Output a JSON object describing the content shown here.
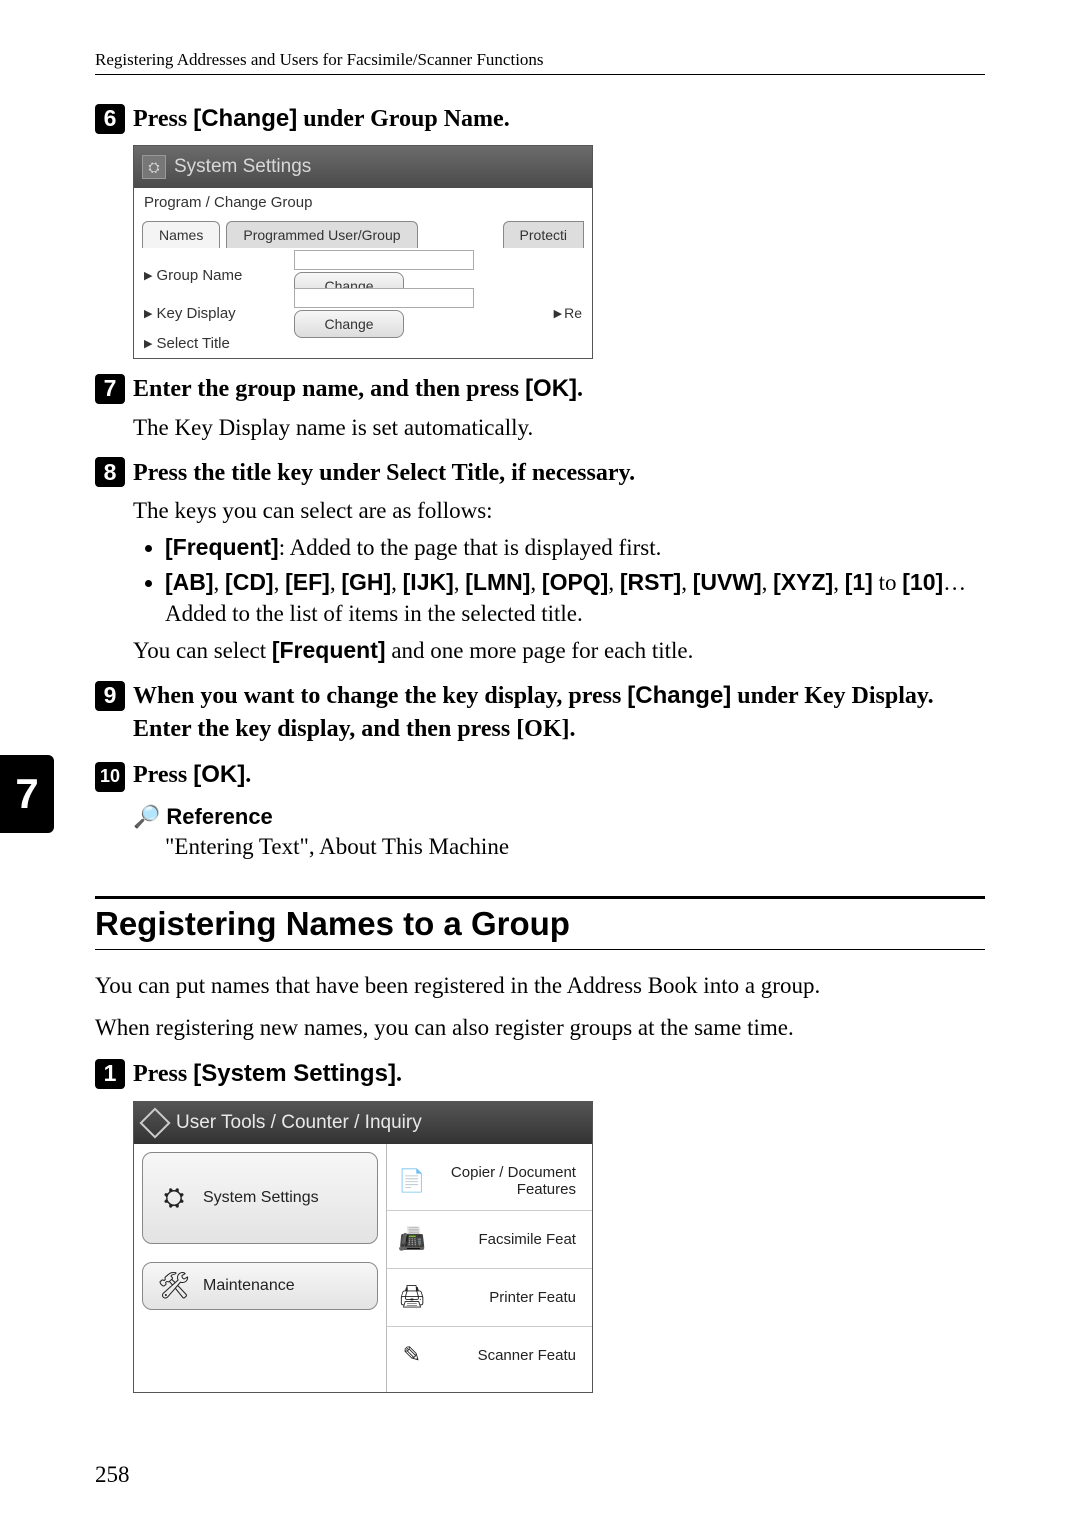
{
  "header": "Registering Addresses and Users for Facsimile/Scanner Functions",
  "side_tab": "7",
  "page_number": "258",
  "steps": {
    "s6": {
      "num": "6",
      "pre": "Press ",
      "kw": "[Change]",
      "post": " under Group Name."
    },
    "s7": {
      "num": "7",
      "pre": "Enter the group name, and then press ",
      "kw": "[OK]",
      "post": "."
    },
    "s7_body": "The Key Display name is set automatically.",
    "s8": {
      "num": "8",
      "text": "Press the title key under Select Title, if necessary."
    },
    "s8_body": "The keys you can select are as follows:",
    "s8_b1_kw": "[Frequent]",
    "s8_b1_rest": ": Added to the page that is displayed first.",
    "s8_b2_keys": [
      "[AB]",
      "[CD]",
      "[EF]",
      "[GH]",
      "[IJK]",
      "[LMN]",
      "[OPQ]",
      "[RST]",
      "[UVW]",
      "[XYZ]",
      "[1]",
      "[10]"
    ],
    "s8_b2_joiner_comma": ", ",
    "s8_b2_joiner_to": " to ",
    "s8_b2_trail": "… Added to the list of items in the selected title.",
    "s8_body2_pre": "You can select ",
    "s8_body2_kw": "[Frequent]",
    "s8_body2_post": " and one more page for each title.",
    "s9": {
      "num": "9",
      "pre": "When you want to change the key display, press ",
      "kw": "[Change]",
      "post": " under Key Display. Enter the key display, and then press [OK]."
    },
    "s10": {
      "num": "10",
      "pre": "Press ",
      "kw": "[OK]",
      "post": "."
    }
  },
  "reference": {
    "label": "Reference",
    "text": "\"Entering Text\", About This Machine"
  },
  "section_heading": "Registering Names to a Group",
  "section_para1": "You can put names that have been registered in the Address Book into a group.",
  "section_para2": "When registering new names, you can also register groups at the same time.",
  "step1": {
    "num": "1",
    "pre": "Press ",
    "kw": "[System Settings]",
    "post": "."
  },
  "shot1": {
    "title": "System Settings",
    "row1": "Program / Change Group",
    "tab_names": "Names",
    "tab_prog": "Programmed User/Group",
    "tab_prot": "Protecti",
    "lbl_group": "Group Name",
    "lbl_key": "Key Display",
    "lbl_select": "Select Title",
    "btn_change": "Change",
    "re_label": "Re"
  },
  "shot2": {
    "title": "User Tools / Counter / Inquiry",
    "btn_system": "System Settings",
    "btn_maint": "Maintenance",
    "r1": "Copier / Document Features",
    "r2": "Facsimile Feat",
    "r3": "Printer Featu",
    "r4": "Scanner Featu"
  }
}
